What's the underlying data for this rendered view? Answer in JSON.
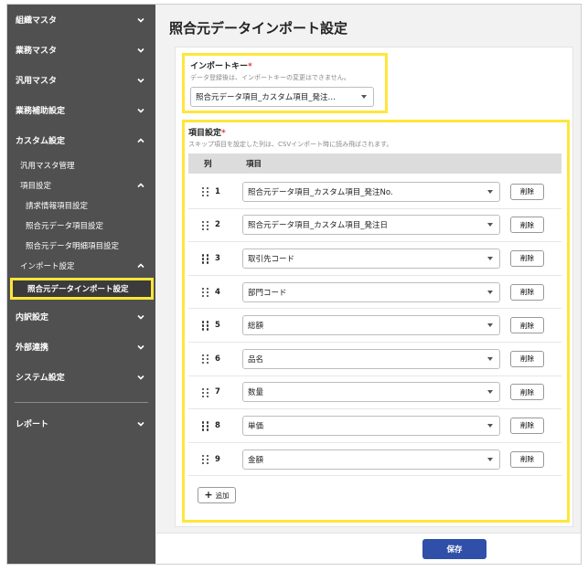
{
  "sidebar": {
    "top_items": [
      {
        "label": "組織マスタ",
        "state": "collapsed"
      },
      {
        "label": "業務マスタ",
        "state": "collapsed"
      },
      {
        "label": "汎用マスタ",
        "state": "collapsed"
      },
      {
        "label": "業務補助設定",
        "state": "collapsed"
      },
      {
        "label": "カスタム設定",
        "state": "expanded"
      }
    ],
    "custom_children": {
      "generic_master": "汎用マスタ管理",
      "item_settings": "項目設定",
      "item_settings_children": [
        "請求情報項目設定",
        "照合元データ項目設定",
        "照合元データ明細項目設定"
      ],
      "import_settings": "インポート設定",
      "active": "照合元データインポート設定"
    },
    "bottom_items": [
      {
        "label": "内訳設定"
      },
      {
        "label": "外部連携"
      },
      {
        "label": "システム設定"
      }
    ],
    "report": "レポート"
  },
  "main": {
    "title": "照合元データインポート設定",
    "import_key": {
      "label": "インポートキー",
      "required": "*",
      "hint": "データ登録後は、インポートキーの変更はできません。",
      "value": "照合元データ項目_カスタム項目_発注…"
    },
    "items": {
      "label": "項目設定",
      "required": "*",
      "hint": "スキップ項目を設定した列は、CSVインポート時に読み飛ばされます。",
      "col_header": "列",
      "item_header": "項目",
      "delete_label": "削除",
      "rows": [
        {
          "num": "1",
          "value": "照合元データ項目_カスタム項目_発注No."
        },
        {
          "num": "2",
          "value": "照合元データ項目_カスタム項目_発注日"
        },
        {
          "num": "3",
          "value": "取引先コード"
        },
        {
          "num": "4",
          "value": "部門コード"
        },
        {
          "num": "5",
          "value": "総額"
        },
        {
          "num": "6",
          "value": "品名"
        },
        {
          "num": "7",
          "value": "数量"
        },
        {
          "num": "8",
          "value": "単価"
        },
        {
          "num": "9",
          "value": "金額"
        }
      ],
      "add_label": "追加"
    },
    "save_label": "保存"
  },
  "colors": {
    "sidebar_bg": "#505050",
    "highlight": "#ffe63a",
    "primary_button": "#2f4fa8",
    "required_mark": "#e53935"
  },
  "icons": {
    "collapsed": "chevron-down-icon",
    "expanded": "chevron-up-icon",
    "drag": "drag-handle-icon",
    "add": "plus-icon"
  }
}
